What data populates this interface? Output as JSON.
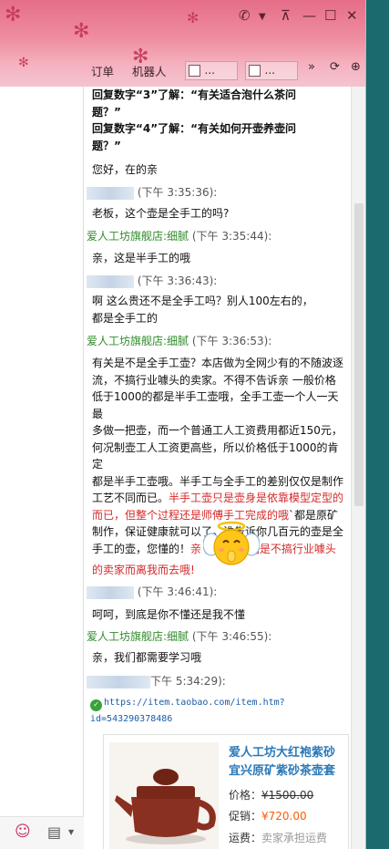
{
  "titlebar": {
    "phone_icon": "phone-icon",
    "tabs": [
      "订单",
      "机器人"
    ],
    "tab_box_1": "...",
    "tab_box_2": "...",
    "more": "»"
  },
  "messages": {
    "reply3_line1": "回复数字“3”了解：“有关适合泡什么茶问",
    "reply3_line2": "题？”",
    "reply4_line1": "回复数字“4”了解：“有关如何开壶养壶问",
    "reply4_line2": "题？”",
    "greeting": "您好，在的亲",
    "t1": "(下午 3:35:36):",
    "q1": "老板，这个壶是全手工的吗?",
    "shop_name": "爱人工坊旗舰店:细腻",
    "t2": " (下午 3:35:44):",
    "a1": "亲，这是半手工的哦",
    "t3": "(下午 3:36:43):",
    "q2_line1": "啊          这么贵还不是全手工吗？别人100左右的，",
    "q2_line2": "都是全手工的",
    "t4": " (下午 3:36:53):",
    "a2_lines": [
      "有关是不是全手工壶？本店做为全网少有的不随波逐",
      "流，不搞行业噱头的卖家。不得不告诉亲   一般价格",
      "低于1000的都是半手工壶哦，全手工壶一个人一天最",
      "多做一把壶，而一个普通工人工资费用都近150元，",
      "何况制壶工人工资更高些，所以价格低于1000的肯定",
      "都是半手工壶哦。半手工与全手工的差别仅仅是制作"
    ],
    "a2_l7_black": "工艺不同而已。",
    "a2_l7_red": "半手工壶只是壶身是依靠模型定型的",
    "a2_l8_red": "而已，但整个过程还是师傅手工完成的哦",
    "a2_l8_black": "`都是原矿",
    "a2_l9": "制作，保证健康就可以了。谁告诉你几百元的壶是全",
    "a2_l10_black": "手工的壶，您懂的！",
    "a2_l10_red": "亲   别因为我们是不搞行业噱头",
    "a2_tail_red": "的卖家而离我而去哦!",
    "t5": "(下午 3:46:41):",
    "q3": "呵呵，到底是你不懂还是我不懂",
    "t6": " (下午 3:46:55):",
    "a3": "亲，我们都需要学习哦",
    "t7": "下午 5:34:29):",
    "link_line1": "https://item.taobao.com/item.htm?",
    "link_line2": "id=543290378486"
  },
  "product": {
    "title_line1": "爱人工坊大红袍紫砂",
    "title_line2": "宜兴原矿紫砂茶壶套",
    "price_label": "价格：",
    "price_value": "¥1500.00",
    "promo_label": "促销：",
    "promo_value": "¥720.00",
    "ship_label": "运费：",
    "ship_value": "卖家承担运费"
  },
  "colors": {
    "accent_green": "#2f8c2a",
    "red_text": "#d42a2a",
    "link_blue": "#1a5ba8",
    "title_pink": "#e97b93"
  }
}
